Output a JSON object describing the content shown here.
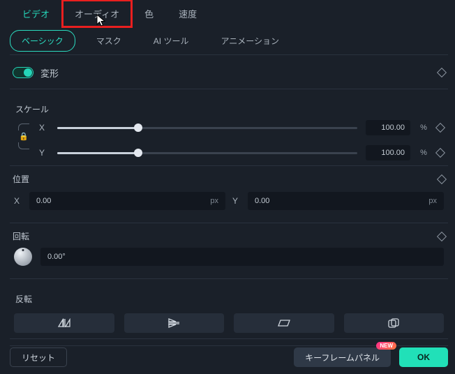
{
  "main_tabs": {
    "video": "ビデオ",
    "audio": "オーディオ",
    "color": "色",
    "speed": "速度"
  },
  "sub_tabs": {
    "basic": "ベーシック",
    "mask": "マスク",
    "ai": "AI ツール",
    "anim": "アニメーション"
  },
  "transform": {
    "title": "変形"
  },
  "scale": {
    "label": "スケール",
    "x_label": "X",
    "y_label": "Y",
    "x_value": "100.00",
    "y_value": "100.00",
    "unit": "%",
    "x_percent": 27,
    "y_percent": 27
  },
  "position": {
    "label": "位置",
    "x_label": "X",
    "y_label": "Y",
    "x_value": "0.00",
    "y_value": "0.00",
    "unit": "px"
  },
  "rotation": {
    "label": "回転",
    "value": "0.00°"
  },
  "flip": {
    "label": "反転",
    "horiz_icon": "⧋",
    "vert_icon": "⧊",
    "skew_icon": "▱",
    "copy_icon": "❐"
  },
  "footer": {
    "reset": "リセット",
    "keyframe": "キーフレームパネル",
    "new_badge": "NEW",
    "ok": "OK"
  }
}
